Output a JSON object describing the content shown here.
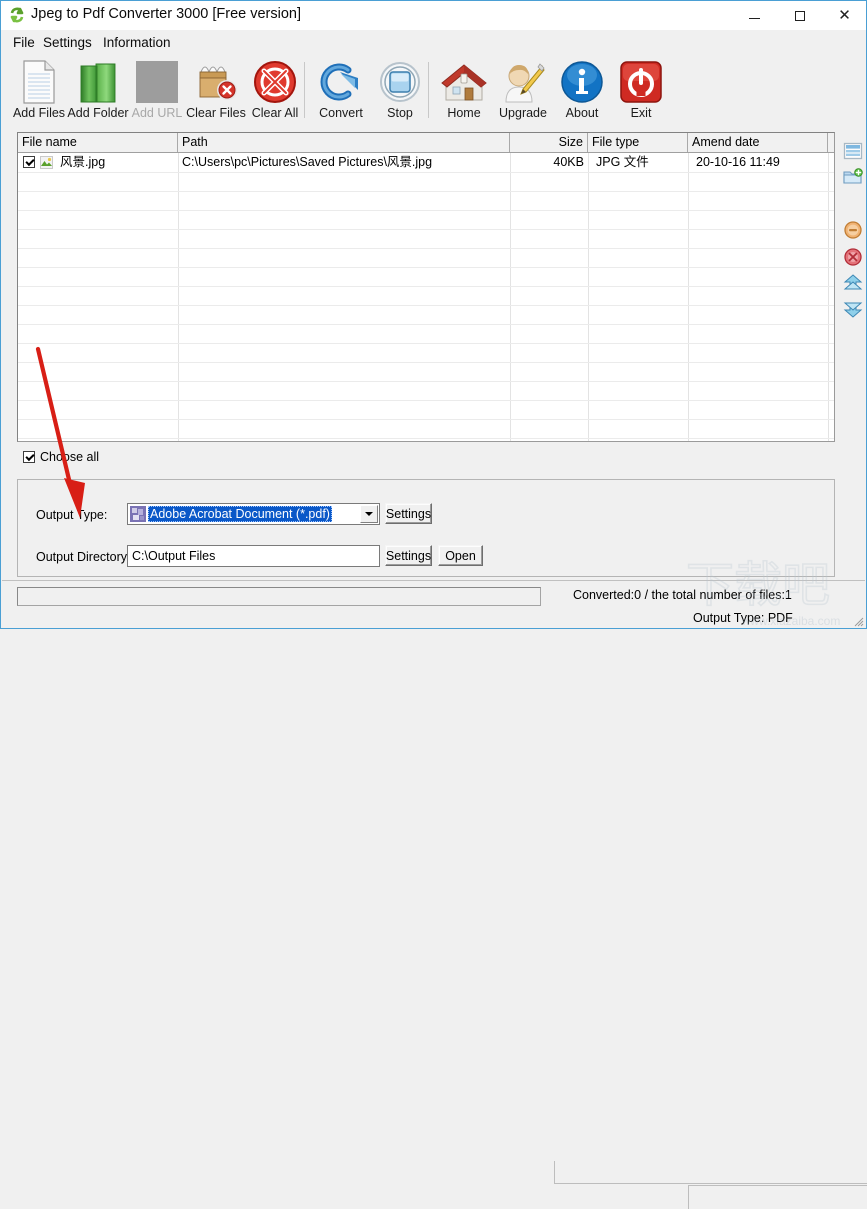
{
  "window": {
    "title": "Jpeg to Pdf Converter 3000 [Free version]",
    "icon": "recycle-convert-icon",
    "controls": {
      "minimize": "Minimize",
      "maximize": "Maximize",
      "close": "Close"
    }
  },
  "menu": [
    {
      "label": "File"
    },
    {
      "label": "Settings"
    },
    {
      "label": "Information"
    }
  ],
  "toolbar": [
    {
      "label": "Add Files",
      "icon": "document-page-icon",
      "enabled": true
    },
    {
      "label": "Add Folder",
      "icon": "green-folder-icon",
      "enabled": true
    },
    {
      "label": "Add URL",
      "icon": "blank-gray-icon",
      "enabled": false
    },
    {
      "label": "Clear Files",
      "icon": "box-remove-icon",
      "enabled": true
    },
    {
      "label": "Clear All",
      "icon": "red-cross-circle-icon",
      "enabled": true
    },
    {
      "label": "Convert",
      "icon": "blue-go-arrow-icon",
      "enabled": true
    },
    {
      "label": "Stop",
      "icon": "stop-square-icon",
      "enabled": true
    },
    {
      "label": "Home",
      "icon": "house-icon",
      "enabled": true
    },
    {
      "label": "Upgrade",
      "icon": "user-pencil-icon",
      "enabled": true
    },
    {
      "label": "About",
      "icon": "blue-info-icon",
      "enabled": true
    },
    {
      "label": "Exit",
      "icon": "red-power-icon",
      "enabled": true
    }
  ],
  "filelist": {
    "columns": [
      {
        "label": "File name"
      },
      {
        "label": "Path"
      },
      {
        "label": "Size"
      },
      {
        "label": "File type"
      },
      {
        "label": "Amend date"
      }
    ],
    "rows": [
      {
        "checked": true,
        "icon": "jpeg-thumbnail-icon",
        "name": "风景.jpg",
        "path": "C:\\Users\\pc\\Pictures\\Saved Pictures\\风景.jpg",
        "size": "40KB",
        "type": "JPG 文件",
        "date": "20-10-16 11:49"
      }
    ]
  },
  "choose_all": {
    "label": "Choose all",
    "checked": true
  },
  "output": {
    "type_label": "Output Type:",
    "type_value": "Adobe Acrobat Document (*.pdf)",
    "type_icon": "pdf-file-icon",
    "type_settings_label": "Settings",
    "directory_label": "Output Directory:",
    "directory_value": "C:\\Output Files",
    "directory_settings_label": "Settings",
    "directory_open_label": "Open"
  },
  "status": {
    "progress_percent": 0,
    "converted_text": "Converted:0  /  the total number of files:1",
    "output_type_text": "Output Type: PDF"
  },
  "side_tools": [
    {
      "icon": "list-window-icon"
    },
    {
      "icon": "add-folder-icon"
    },
    {
      "icon": "remove-minus-icon"
    },
    {
      "icon": "delete-red-icon"
    },
    {
      "icon": "move-up-icon"
    },
    {
      "icon": "move-down-icon"
    }
  ],
  "watermark": {
    "cn": "下载吧",
    "url": "www.xiazaiba.com"
  },
  "colors": {
    "window_border": "#4a9fd4",
    "face": "#f0f0f0",
    "selection_blue": "#0a58c8",
    "arrow_red": "#d81f16"
  }
}
